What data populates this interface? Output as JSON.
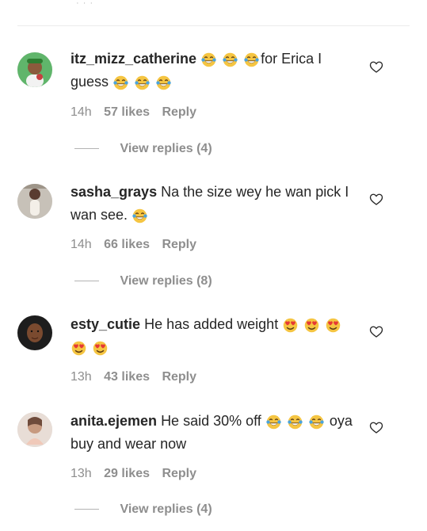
{
  "top": {
    "dots": "· · ·"
  },
  "comments": [
    {
      "username": "itz_mizz_catherine",
      "pre_emoji_text": "",
      "text_after_first_emojis": "for Erica I guess",
      "time": "14h",
      "likes": "57 likes",
      "reply": "Reply",
      "view_replies": "View replies (4)",
      "avatar_icon": "green-avatar-icon",
      "emojis_1": [
        "laughing-emoji-icon",
        "laughing-emoji-icon",
        "laughing-emoji-icon"
      ],
      "emojis_2": [
        "laughing-emoji-icon",
        "laughing-emoji-icon",
        "laughing-emoji-icon"
      ]
    },
    {
      "username": "sasha_grays",
      "text": "Na the size wey he wan pick I wan see.",
      "time": "14h",
      "likes": "66 likes",
      "reply": "Reply",
      "view_replies": "View replies (8)",
      "avatar_icon": "woman-avatar-icon",
      "emojis": [
        "laughing-emoji-icon"
      ]
    },
    {
      "username": "esty_cutie",
      "text": "He has added weight",
      "time": "13h",
      "likes": "43 likes",
      "reply": "Reply",
      "avatar_icon": "woman-portrait-avatar-icon",
      "emojis_1": [
        "heart-eyes-emoji-icon",
        "heart-eyes-emoji-icon",
        "heart-eyes-emoji-icon"
      ],
      "emojis_2": [
        "heart-eyes-emoji-icon",
        "heart-eyes-emoji-icon"
      ]
    },
    {
      "username": "anita.ejemen",
      "text_before_emojis": "He said 30% off",
      "text_after_emojis": "oya buy and wear now",
      "time": "13h",
      "likes": "29 likes",
      "reply": "Reply",
      "view_replies": "View replies (4)",
      "avatar_icon": "light-avatar-icon",
      "emojis": [
        "laughing-emoji-icon",
        "laughing-emoji-icon",
        "laughing-emoji-icon"
      ]
    }
  ],
  "colors": {
    "text": "#262626",
    "meta": "#8e8e8e",
    "divider": "#ececec",
    "emoji_face": "#f5c542",
    "emoji_tears": "#4aa3df",
    "heart_eyes": "#e53935"
  }
}
